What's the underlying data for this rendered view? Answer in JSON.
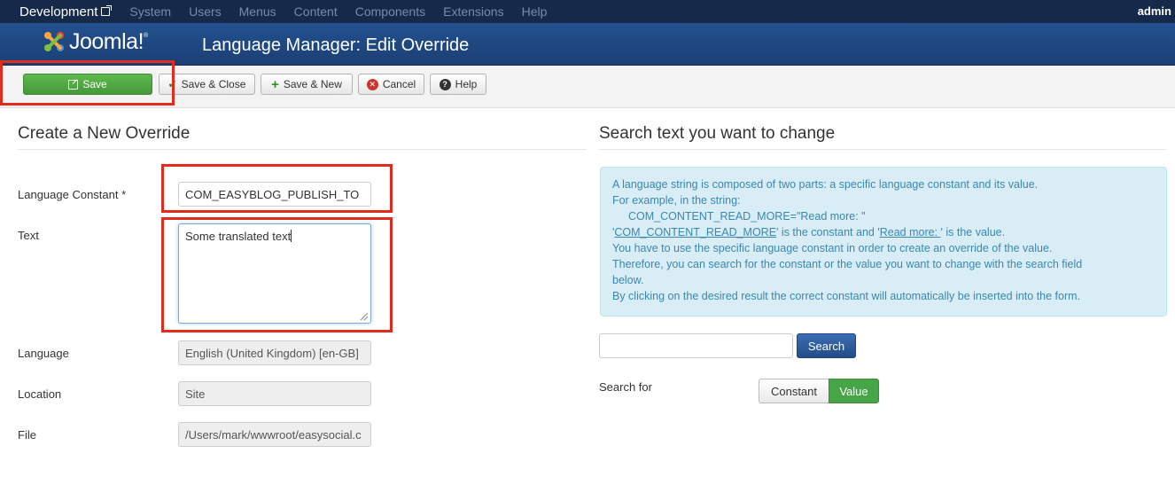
{
  "topnav": {
    "brand": "Development",
    "menu": [
      "System",
      "Users",
      "Menus",
      "Content",
      "Components",
      "Extensions",
      "Help"
    ],
    "user": "admin"
  },
  "header": {
    "logo_text": "Joomla!",
    "logo_reg": "®",
    "title": "Language Manager: Edit Override"
  },
  "toolbar": {
    "save": "Save",
    "save_close": "Save & Close",
    "save_new": "Save & New",
    "cancel": "Cancel",
    "help": "Help"
  },
  "form": {
    "heading": "Create a New Override",
    "constant_label": "Language Constant *",
    "constant_value": "COM_EASYBLOG_PUBLISH_TO",
    "text_label": "Text",
    "text_value": "Some translated text",
    "language_label": "Language",
    "language_value": "English (United Kingdom) [en-GB]",
    "location_label": "Location",
    "location_value": "Site",
    "file_label": "File",
    "file_value": "/Users/mark/wwwroot/easysocial.c"
  },
  "search_panel": {
    "heading": "Search text you want to change",
    "info": {
      "l1": "A language string is composed of two parts: a specific language constant and its value.",
      "l2": "For example, in the string:",
      "l3": "COM_CONTENT_READ_MORE=\"Read more: \"",
      "l4_a": "'",
      "l4_link1": "COM_CONTENT_READ_MORE",
      "l4_b": "' is the constant and '",
      "l4_link2": "Read more: ",
      "l4_c": "' is the value.",
      "l5": "You have to use the specific language constant in order to create an override of the value.",
      "l6": "Therefore, you can search for the constant or the value you want to change with the search field",
      "l7": "below.",
      "l8": "By clicking on the desired result the correct constant will automatically be inserted into the form."
    },
    "search_placeholder": "",
    "search_button": "Search",
    "search_for_label": "Search for",
    "option_constant": "Constant",
    "option_value": "Value",
    "selected_option": "Value"
  },
  "colors": {
    "nav_bg": "#17294a",
    "header_bg": "#23518f",
    "save_green": "#4fa843",
    "highlight_red": "#e02b1f",
    "info_bg": "#d9edf7"
  },
  "icons": [
    "external-link-icon",
    "joomla-logo-icon",
    "edit-icon",
    "check-icon",
    "plus-icon",
    "cancel-icon",
    "help-icon",
    "resize-grip-icon"
  ]
}
